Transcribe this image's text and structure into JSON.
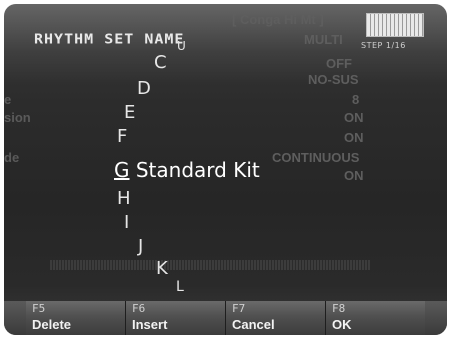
{
  "header": {
    "title": "RHYTHM SET NAME",
    "step_label": "STEP 1/16"
  },
  "background": {
    "instrument": "[ Conga Hi Mt  ]",
    "right_values": [
      "MULTI",
      "OFF",
      "NO-SUS",
      "8",
      "ON",
      "ON",
      "CONTINUOUS",
      "ON"
    ],
    "left_fragments": [
      "e",
      "sion",
      "de"
    ]
  },
  "char_list": {
    "letters_above": [
      "C",
      "D",
      "E",
      "F"
    ],
    "selected_letter": "G",
    "selected_name_rest": "Standard Kit",
    "letters_below": [
      "H",
      "I",
      "J",
      "K",
      "L"
    ]
  },
  "function_keys": [
    {
      "key": "F5",
      "label": "Delete"
    },
    {
      "key": "F6",
      "label": "Insert"
    },
    {
      "key": "F7",
      "label": "Cancel"
    },
    {
      "key": "F8",
      "label": "OK"
    }
  ]
}
